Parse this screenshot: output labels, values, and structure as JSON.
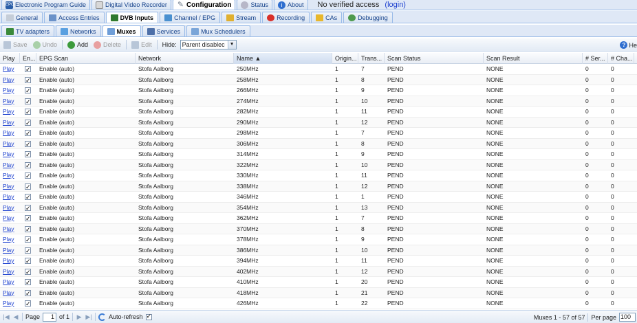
{
  "top_tabs": [
    {
      "label": "Electronic Program Guide",
      "icon": "epg-icon"
    },
    {
      "label": "Digital Video Recorder",
      "icon": "dvr-icon"
    },
    {
      "label": "Configuration",
      "icon": "wrench-icon"
    },
    {
      "label": "Status",
      "icon": "status-icon"
    },
    {
      "label": "About",
      "icon": "info-icon"
    }
  ],
  "access_message": "No verified access",
  "login_link": "(login)",
  "config_tabs": [
    {
      "label": "General"
    },
    {
      "label": "Access Entries"
    },
    {
      "label": "DVB Inputs"
    },
    {
      "label": "Channel / EPG"
    },
    {
      "label": "Stream"
    },
    {
      "label": "Recording"
    },
    {
      "label": "CAs"
    },
    {
      "label": "Debugging"
    }
  ],
  "dvb_tabs": [
    {
      "label": "TV adapters"
    },
    {
      "label": "Networks"
    },
    {
      "label": "Muxes"
    },
    {
      "label": "Services"
    },
    {
      "label": "Mux Schedulers"
    }
  ],
  "toolbar": {
    "save": "Save",
    "undo": "Undo",
    "add": "Add",
    "delete": "Delete",
    "edit": "Edit",
    "hide_label": "Hide:",
    "hide_value": "Parent disablec",
    "help": "He"
  },
  "columns": [
    "Play",
    "En...",
    "EPG Scan",
    "Network",
    "Name ▲",
    "Origin...",
    "Trans...",
    "Scan Status",
    "Scan Result",
    "# Ser...",
    "# Cha..."
  ],
  "rows": [
    {
      "play": "Play",
      "epg": "Enable (auto)",
      "network": "Stofa Aalborg",
      "name": "250MHz",
      "orig": "1",
      "trans": "7",
      "status": "PEND",
      "result": "NONE",
      "ser": "0",
      "cha": "0"
    },
    {
      "play": "Play",
      "epg": "Enable (auto)",
      "network": "Stofa Aalborg",
      "name": "258MHz",
      "orig": "1",
      "trans": "8",
      "status": "PEND",
      "result": "NONE",
      "ser": "0",
      "cha": "0"
    },
    {
      "play": "Play",
      "epg": "Enable (auto)",
      "network": "Stofa Aalborg",
      "name": "266MHz",
      "orig": "1",
      "trans": "9",
      "status": "PEND",
      "result": "NONE",
      "ser": "0",
      "cha": "0"
    },
    {
      "play": "Play",
      "epg": "Enable (auto)",
      "network": "Stofa Aalborg",
      "name": "274MHz",
      "orig": "1",
      "trans": "10",
      "status": "PEND",
      "result": "NONE",
      "ser": "0",
      "cha": "0"
    },
    {
      "play": "Play",
      "epg": "Enable (auto)",
      "network": "Stofa Aalborg",
      "name": "282MHz",
      "orig": "1",
      "trans": "11",
      "status": "PEND",
      "result": "NONE",
      "ser": "0",
      "cha": "0"
    },
    {
      "play": "Play",
      "epg": "Enable (auto)",
      "network": "Stofa Aalborg",
      "name": "290MHz",
      "orig": "1",
      "trans": "12",
      "status": "PEND",
      "result": "NONE",
      "ser": "0",
      "cha": "0"
    },
    {
      "play": "Play",
      "epg": "Enable (auto)",
      "network": "Stofa Aalborg",
      "name": "298MHz",
      "orig": "1",
      "trans": "7",
      "status": "PEND",
      "result": "NONE",
      "ser": "0",
      "cha": "0"
    },
    {
      "play": "Play",
      "epg": "Enable (auto)",
      "network": "Stofa Aalborg",
      "name": "306MHz",
      "orig": "1",
      "trans": "8",
      "status": "PEND",
      "result": "NONE",
      "ser": "0",
      "cha": "0"
    },
    {
      "play": "Play",
      "epg": "Enable (auto)",
      "network": "Stofa Aalborg",
      "name": "314MHz",
      "orig": "1",
      "trans": "9",
      "status": "PEND",
      "result": "NONE",
      "ser": "0",
      "cha": "0"
    },
    {
      "play": "Play",
      "epg": "Enable (auto)",
      "network": "Stofa Aalborg",
      "name": "322MHz",
      "orig": "1",
      "trans": "10",
      "status": "PEND",
      "result": "NONE",
      "ser": "0",
      "cha": "0"
    },
    {
      "play": "Play",
      "epg": "Enable (auto)",
      "network": "Stofa Aalborg",
      "name": "330MHz",
      "orig": "1",
      "trans": "11",
      "status": "PEND",
      "result": "NONE",
      "ser": "0",
      "cha": "0"
    },
    {
      "play": "Play",
      "epg": "Enable (auto)",
      "network": "Stofa Aalborg",
      "name": "338MHz",
      "orig": "1",
      "trans": "12",
      "status": "PEND",
      "result": "NONE",
      "ser": "0",
      "cha": "0"
    },
    {
      "play": "Play",
      "epg": "Enable (auto)",
      "network": "Stofa Aalborg",
      "name": "346MHz",
      "orig": "1",
      "trans": "1",
      "status": "PEND",
      "result": "NONE",
      "ser": "0",
      "cha": "0"
    },
    {
      "play": "Play",
      "epg": "Enable (auto)",
      "network": "Stofa Aalborg",
      "name": "354MHz",
      "orig": "1",
      "trans": "13",
      "status": "PEND",
      "result": "NONE",
      "ser": "0",
      "cha": "0"
    },
    {
      "play": "Play",
      "epg": "Enable (auto)",
      "network": "Stofa Aalborg",
      "name": "362MHz",
      "orig": "1",
      "trans": "7",
      "status": "PEND",
      "result": "NONE",
      "ser": "0",
      "cha": "0"
    },
    {
      "play": "Play",
      "epg": "Enable (auto)",
      "network": "Stofa Aalborg",
      "name": "370MHz",
      "orig": "1",
      "trans": "8",
      "status": "PEND",
      "result": "NONE",
      "ser": "0",
      "cha": "0"
    },
    {
      "play": "Play",
      "epg": "Enable (auto)",
      "network": "Stofa Aalborg",
      "name": "378MHz",
      "orig": "1",
      "trans": "9",
      "status": "PEND",
      "result": "NONE",
      "ser": "0",
      "cha": "0"
    },
    {
      "play": "Play",
      "epg": "Enable (auto)",
      "network": "Stofa Aalborg",
      "name": "386MHz",
      "orig": "1",
      "trans": "10",
      "status": "PEND",
      "result": "NONE",
      "ser": "0",
      "cha": "0"
    },
    {
      "play": "Play",
      "epg": "Enable (auto)",
      "network": "Stofa Aalborg",
      "name": "394MHz",
      "orig": "1",
      "trans": "11",
      "status": "PEND",
      "result": "NONE",
      "ser": "0",
      "cha": "0"
    },
    {
      "play": "Play",
      "epg": "Enable (auto)",
      "network": "Stofa Aalborg",
      "name": "402MHz",
      "orig": "1",
      "trans": "12",
      "status": "PEND",
      "result": "NONE",
      "ser": "0",
      "cha": "0"
    },
    {
      "play": "Play",
      "epg": "Enable (auto)",
      "network": "Stofa Aalborg",
      "name": "410MHz",
      "orig": "1",
      "trans": "20",
      "status": "PEND",
      "result": "NONE",
      "ser": "0",
      "cha": "0"
    },
    {
      "play": "Play",
      "epg": "Enable (auto)",
      "network": "Stofa Aalborg",
      "name": "418MHz",
      "orig": "1",
      "trans": "21",
      "status": "PEND",
      "result": "NONE",
      "ser": "0",
      "cha": "0"
    },
    {
      "play": "Play",
      "epg": "Enable (auto)",
      "network": "Stofa Aalborg",
      "name": "426MHz",
      "orig": "1",
      "trans": "22",
      "status": "PEND",
      "result": "NONE",
      "ser": "0",
      "cha": "0"
    }
  ],
  "paging": {
    "page_label": "Page",
    "page_value": "1",
    "of_label": "of 1",
    "auto_refresh": "Auto-refresh",
    "summary": "Muxes 1 - 57 of 57",
    "per_page_label": "Per page",
    "per_page_value": "100"
  }
}
